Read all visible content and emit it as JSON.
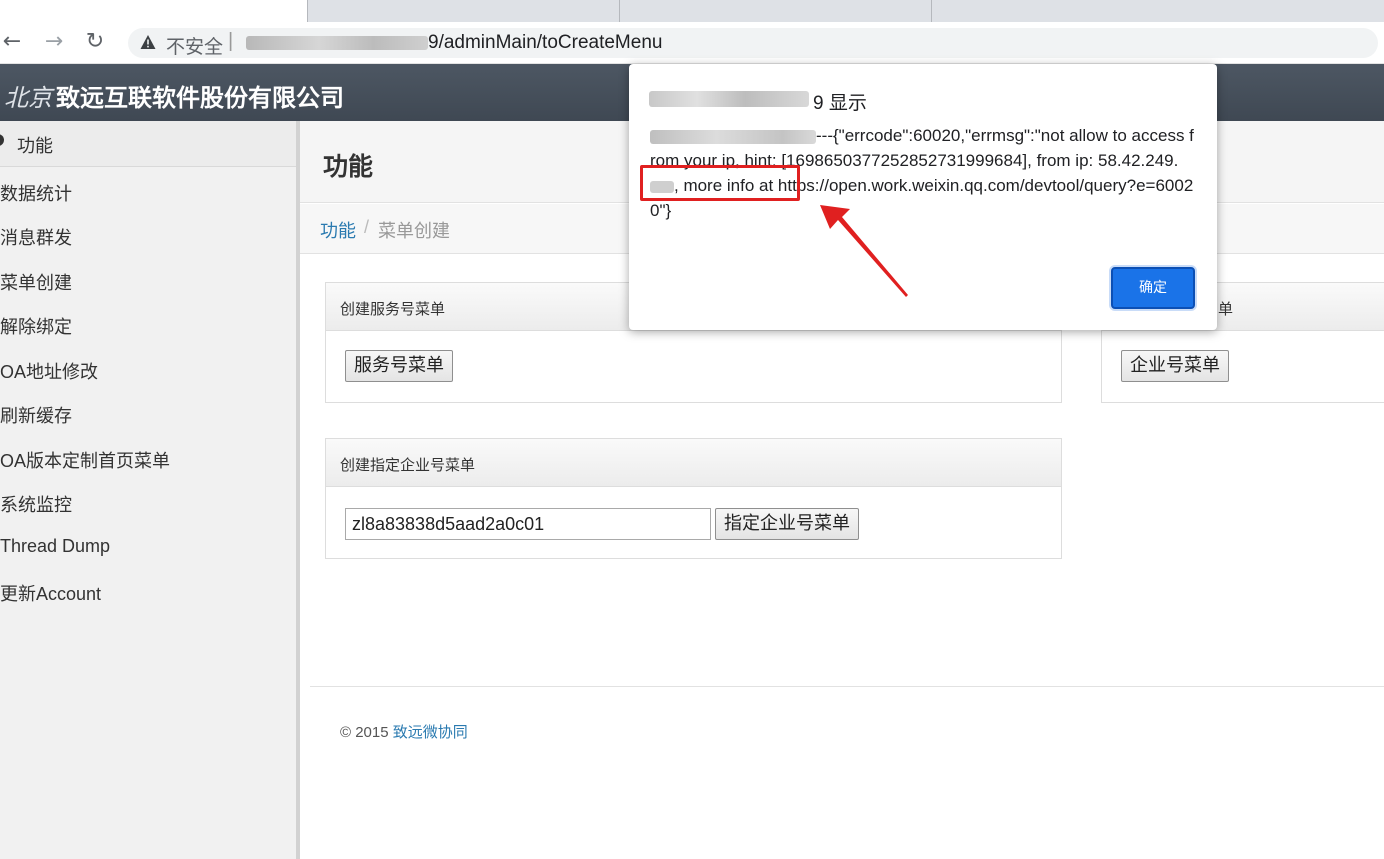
{
  "browser": {
    "security_label": "不安全",
    "separator": "|",
    "url_suffix": "9/adminMain/toCreateMenu",
    "back_icon": "back-arrow-icon",
    "forward_icon": "forward-arrow-icon",
    "reload_icon": "reload-icon",
    "warning_icon": "warning-triangle-icon"
  },
  "header": {
    "city": "北京",
    "company": "致远互联软件股份有限公司"
  },
  "sidebar": {
    "section": "功能",
    "items": [
      {
        "label": "数据统计"
      },
      {
        "label": "消息群发"
      },
      {
        "label": "菜单创建"
      },
      {
        "label": "解除绑定"
      },
      {
        "label": "OA地址修改"
      },
      {
        "label": "刷新缓存"
      },
      {
        "label": "OA版本定制首页菜单"
      },
      {
        "label": "系统监控"
      },
      {
        "label": "Thread Dump"
      },
      {
        "label": "更新Account"
      }
    ]
  },
  "main": {
    "title": "功能",
    "breadcrumb": {
      "root": "功能",
      "sep": "/",
      "current": "菜单创建"
    },
    "panels": {
      "service": {
        "title": "创建服务号菜单",
        "button": "服务号菜单"
      },
      "enterprise": {
        "title_suffix": "单",
        "button": "企业号菜单"
      },
      "specified": {
        "title": "创建指定企业号菜单",
        "input_value": "zl8a83838d5aad2a0c01",
        "button": "指定企业号菜单"
      }
    },
    "footer": {
      "copyright": "© 2015",
      "link": "致远微协同"
    }
  },
  "dialog": {
    "title_visible": "9 显示",
    "message_part1": "---{\"errcode\":60020,\"errmsg\":\"not allow to access from your ip, hint: [1698650377252852731999684], from ip: 58.42.249.",
    "message_part2": ", more info at https://open.work.weixin.qq.com/devtool/query?e=60020\"}",
    "ok_label": "确定"
  },
  "annotation": {
    "box_color": "#e02020",
    "arrow_color": "#e02020"
  }
}
